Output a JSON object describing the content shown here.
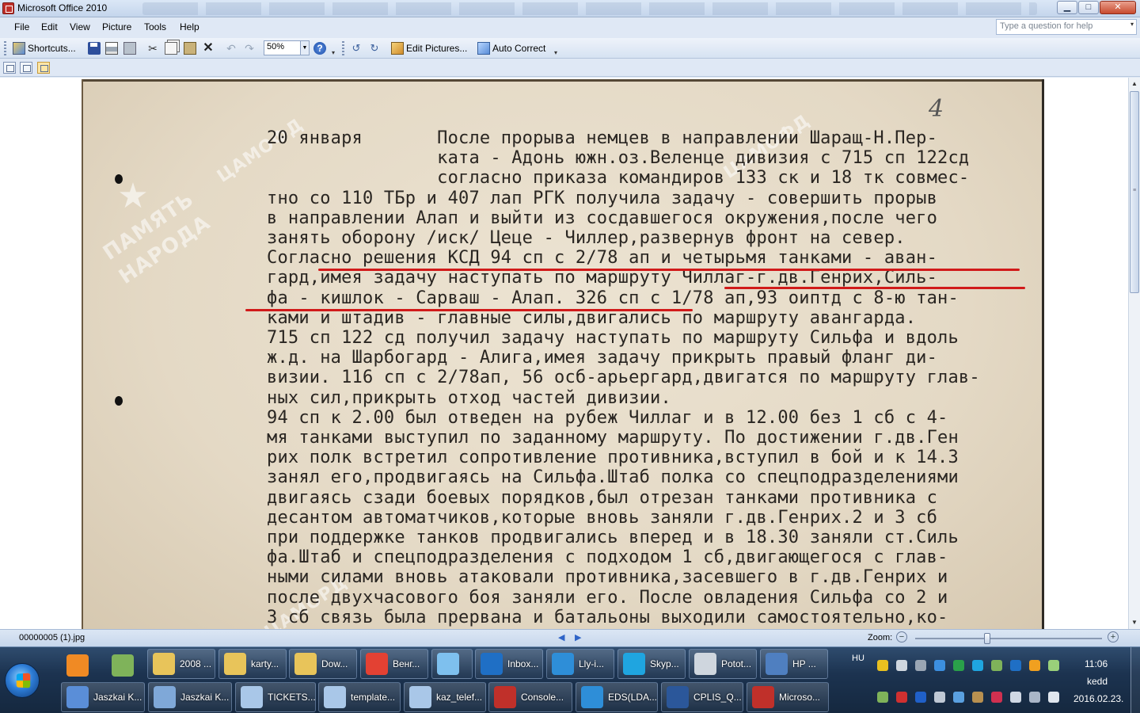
{
  "window": {
    "title": "Microsoft Office 2010",
    "min_glyph": "▁",
    "max_glyph": "□",
    "close_glyph": "✕"
  },
  "menu": [
    "File",
    "Edit",
    "View",
    "Picture",
    "Tools",
    "Help"
  ],
  "ask": {
    "placeholder": "Type a question for help",
    "drop": "▾"
  },
  "toolbar": {
    "shortcuts_label": "Shortcuts...",
    "zoom_value": "50%",
    "edit_pictures_label": "Edit Pictures...",
    "auto_correct_label": "Auto Correct",
    "icons": [
      "shortcuts-icon",
      "save-icon",
      "print-icon",
      "print-preview-icon",
      "cut-icon",
      "copy-icon",
      "paste-icon",
      "delete-icon",
      "undo-icon",
      "redo-icon",
      "help-icon",
      "rotate-left-icon",
      "rotate-right-icon",
      "edit-pictures-icon",
      "auto-correct-icon"
    ]
  },
  "document": {
    "page_number": "4",
    "watermark_1": "ЦАМОФД",
    "watermark_2": "ЦАМОФД",
    "watermark_3": "ЦАМОРД",
    "watermark_main_1": "ПАМЯТЬ",
    "watermark_main_2": "НАРОДА",
    "lines": [
      "20 января       После прорыва немцев в направлении Шаращ-Н.Пер-",
      "                ката - Адонь южн.оз.Веленце дивизия с 715 сп 122сд",
      "                согласно приказа командиров 133 ск и 18 тк совмес-",
      "тно со 110 ТБр и 407 лап РГК получила задачу - совершить прорыв",
      "в направлении Алап и выйти из сосдавшегося окружения,после чего",
      "занять оборону /иск/ Цеце - Чиллер,развернув фронт на север.",
      "Согласно решения КСД 94 сп с 2/78 ап и четырьмя танками - аван-",
      "гард,имея задачу наступать по маршруту Чиллаг-г.дв.Генрих,Силь-",
      "фа - кишлок - Сарваш - Алап. 326 сп с 1/78 ап,93 оиптд с 8-ю тан-",
      "ками и штадив - главные силы,двигались по маршруту авангарда.",
      "715 сп 122 сд получил задачу наступать по маршруту Сильфа и вдоль",
      "ж.д. на Шарбогард - Алига,имея задачу прикрыть правый фланг ди-",
      "визии. 116 сп с 2/78ап, 56 осб-арьергард,двигатся по маршруту глав-",
      "ных сил,прикрыть отход частей дивизии.",
      "94 сп к 2.00 был отведен на рубеж Чиллаг и в 12.00 без 1 сб с 4-",
      "мя танками выступил по заданному маршруту. По достижении г.дв.Ген",
      "рих полк встретил сопротивление противника,вступил в бой и к 14.3",
      "занял его,продвигаясь на Сильфа.Штаб полка со спецподразделениями",
      "двигаясь сзади боевых порядков,был отрезан танками противника с",
      "десантом автоматчиков,которые вновь заняли г.дв.Генрих.2 и 3 сб",
      "при поддержке танков продвигались вперед и в 18.30 заняли ст.Силь",
      "фа.Штаб и спецподразделения с подходом 1 сб,двигающегося с глав-",
      "ными силами вновь атаковали противника,засевшего в г.дв.Генрих и",
      "после двухчасового боя заняли его. После овладения Сильфа со 2 и",
      "3 сб связь была прервана и батальоны выходили самостоятельно,ко-"
    ]
  },
  "scrollbar": {
    "up_arrow": "▲",
    "down_arrow": "▼",
    "grip": "≡",
    "thumb_position": 0.0
  },
  "status": {
    "file_name": "00000005 (1).jpg",
    "prev_arrow": "◀",
    "next_arrow": "▶",
    "zoom_label": "Zoom:",
    "zoom_minus": "−",
    "zoom_plus": "+",
    "zoom_level": 0.38
  },
  "taskbar": {
    "row1": [
      {
        "label": "2008 ...",
        "icon": "folder-icon",
        "color": "#e8c45a"
      },
      {
        "label": "karty...",
        "icon": "folder-icon",
        "color": "#e8c45a"
      },
      {
        "label": "Dow...",
        "icon": "folder-icon",
        "color": "#e8c45a"
      },
      {
        "label": "Венг...",
        "icon": "chrome-icon",
        "color": "#e34133"
      },
      {
        "label": "",
        "icon": "file-manager-icon",
        "color": "#7ec0ee"
      },
      {
        "label": "Inbox...",
        "icon": "outlook-icon",
        "color": "#1f6fc5"
      },
      {
        "label": "Lly-i...",
        "icon": "ie-icon",
        "color": "#2e8ed8"
      },
      {
        "label": "Skyp...",
        "icon": "skype-icon",
        "color": "#1fa5e0"
      },
      {
        "label": "Potot...",
        "icon": "chat-icon",
        "color": "#cfd6de"
      },
      {
        "label": "HP ...",
        "icon": "hp-icon",
        "color": "#4f7fc0"
      }
    ],
    "row2": [
      {
        "label": "Jaszkai K...",
        "icon": "remote-desktop-icon",
        "color": "#5a8ed8"
      },
      {
        "label": "Jaszkai K...",
        "icon": "monitor-icon",
        "color": "#7fa8d8"
      },
      {
        "label": "TICKETS...",
        "icon": "document-icon",
        "color": "#a9c7e8"
      },
      {
        "label": "template...",
        "icon": "document-icon",
        "color": "#a9c7e8"
      },
      {
        "label": "kaz_telef...",
        "icon": "document-icon",
        "color": "#a9c7e8"
      },
      {
        "label": "Console...",
        "icon": "console-icon",
        "color": "#c0302a"
      },
      {
        "label": "EDS(LDA...",
        "icon": "ie-icon",
        "color": "#2e8ed8"
      },
      {
        "label": "CPLIS_Q...",
        "icon": "word-icon",
        "color": "#2b579a"
      },
      {
        "label": "Microso...",
        "icon": "picture-manager-icon",
        "color": "#c0302a"
      }
    ],
    "pinned": [
      {
        "icon": "media-player-icon",
        "color": "#f08a24"
      },
      {
        "icon": "network-tool-icon",
        "color": "#7fb35a"
      }
    ]
  },
  "tray": {
    "lang": "HU",
    "time": "11:06",
    "day": "kedd",
    "date": "2016.02.23.",
    "icons_row1": [
      "shield-icon",
      "pen-icon",
      "clock-icon",
      "globe-icon",
      "it-icon",
      "skype-tray-icon",
      "network-icon",
      "outlook-tray-icon",
      "update-icon",
      "users-icon"
    ],
    "icons_row2": [
      "flag-icon",
      "no-network-icon",
      "bluetooth-icon",
      "usb-icon",
      "sync-icon",
      "storage-icon",
      "antivirus-icon",
      "action-center-icon",
      "display-icon",
      "volume-icon"
    ],
    "colors_row1": [
      "#e8c020",
      "#cfd6de",
      "#9aa6b4",
      "#3c8fe0",
      "#2aa04a",
      "#1fa5e0",
      "#7fb35a",
      "#1f6fc5",
      "#f0a020",
      "#9ad07a"
    ],
    "colors_row2": [
      "#7fb35a",
      "#d03030",
      "#2060c8",
      "#bfc8d4",
      "#5aa0e0",
      "#b89050",
      "#d03050",
      "#d0d8e4",
      "#aab6c8",
      "#e0e6ee"
    ]
  }
}
